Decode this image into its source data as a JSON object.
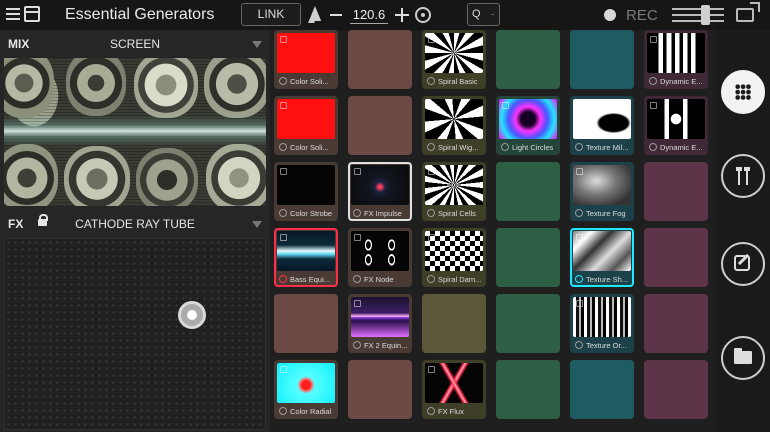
{
  "app": {
    "title": "Essential Generators"
  },
  "toolbar": {
    "link_label": "LINK",
    "tempo": "120.6",
    "quantize_label": "Q",
    "quantize_value": "-",
    "rec_label": "REC",
    "master_level": 0.68
  },
  "mix": {
    "label": "MIX",
    "blend_mode": "SCREEN"
  },
  "fx": {
    "label": "FX",
    "effect": "CATHODE RAY TUBE",
    "pad_x": 0.74,
    "pad_y": 0.38
  },
  "colors": {
    "accent_red": "#ff2c4a",
    "accent_cyan": "#22e6ff",
    "col_brown": "#6b4a45",
    "col_olive": "#5a5838",
    "col_green": "#2d5f44",
    "col_teal": "#1f5b62",
    "col_plum": "#5e3448"
  },
  "columns": [
    {
      "color": "#6b4a45",
      "bar": "#4a3a34",
      "cells": [
        {
          "label": "Color Soli...",
          "thumb": "red"
        },
        {
          "label": "Color Soli...",
          "thumb": "red"
        },
        {
          "label": "Color Strobe",
          "thumb": "black"
        },
        {
          "label": "Bass Equi...",
          "thumb": "wave",
          "state": "red"
        },
        {
          "label": "",
          "thumb": ""
        },
        {
          "label": "Color Radial",
          "thumb": "radial"
        }
      ]
    },
    {
      "color": "#6b4a45",
      "bar": "#4a3a34",
      "cells": [
        {
          "label": "",
          "thumb": ""
        },
        {
          "label": "",
          "thumb": ""
        },
        {
          "label": "FX Impulse",
          "thumb": "impulse",
          "state": "active"
        },
        {
          "label": "FX Node",
          "thumb": "node"
        },
        {
          "label": "FX 2 Equin...",
          "thumb": "synth"
        },
        {
          "label": "",
          "thumb": ""
        }
      ]
    },
    {
      "color": "#5a5838",
      "bar": "#3f3e27",
      "cells": [
        {
          "label": "Spiral Basic",
          "thumb": "spiral"
        },
        {
          "label": "Spiral Wig...",
          "thumb": "spiral2"
        },
        {
          "label": "Spiral Cells",
          "thumb": "spiral3"
        },
        {
          "label": "Spiral Dam...",
          "thumb": "checker"
        },
        {
          "label": "",
          "thumb": ""
        },
        {
          "label": "FX Flux",
          "thumb": "flux"
        }
      ]
    },
    {
      "color": "#2d5f44",
      "bar": "#24463a",
      "cells": [
        {
          "label": "",
          "thumb": ""
        },
        {
          "label": "Light Circles",
          "thumb": "circles"
        },
        {
          "label": "",
          "thumb": ""
        },
        {
          "label": "",
          "thumb": ""
        },
        {
          "label": "",
          "thumb": ""
        },
        {
          "label": "",
          "thumb": ""
        }
      ]
    },
    {
      "color": "#1f5b62",
      "bar": "#1c4148",
      "cells": [
        {
          "label": "",
          "thumb": ""
        },
        {
          "label": "Texture Mil...",
          "thumb": "milk"
        },
        {
          "label": "Texture Fog",
          "thumb": "fog"
        },
        {
          "label": "Texture Sh...",
          "thumb": "shards",
          "state": "cyan"
        },
        {
          "label": "Texture Or...",
          "thumb": "bars"
        },
        {
          "label": "",
          "thumb": ""
        }
      ]
    },
    {
      "color": "#5e3448",
      "bar": "#3f2936",
      "cells": [
        {
          "label": "Dynamic E...",
          "thumb": "eq"
        },
        {
          "label": "Dynamic E...",
          "thumb": "eq2"
        },
        {
          "label": "",
          "thumb": ""
        },
        {
          "label": "",
          "thumb": ""
        },
        {
          "label": "",
          "thumb": ""
        },
        {
          "label": "",
          "thumb": ""
        }
      ]
    }
  ],
  "rail": {
    "items": [
      {
        "icon": "grid-icon",
        "selected": true
      },
      {
        "icon": "sliders-icon",
        "selected": false
      },
      {
        "icon": "edit-icon",
        "selected": false
      },
      {
        "icon": "folder-icon",
        "selected": false
      }
    ]
  }
}
